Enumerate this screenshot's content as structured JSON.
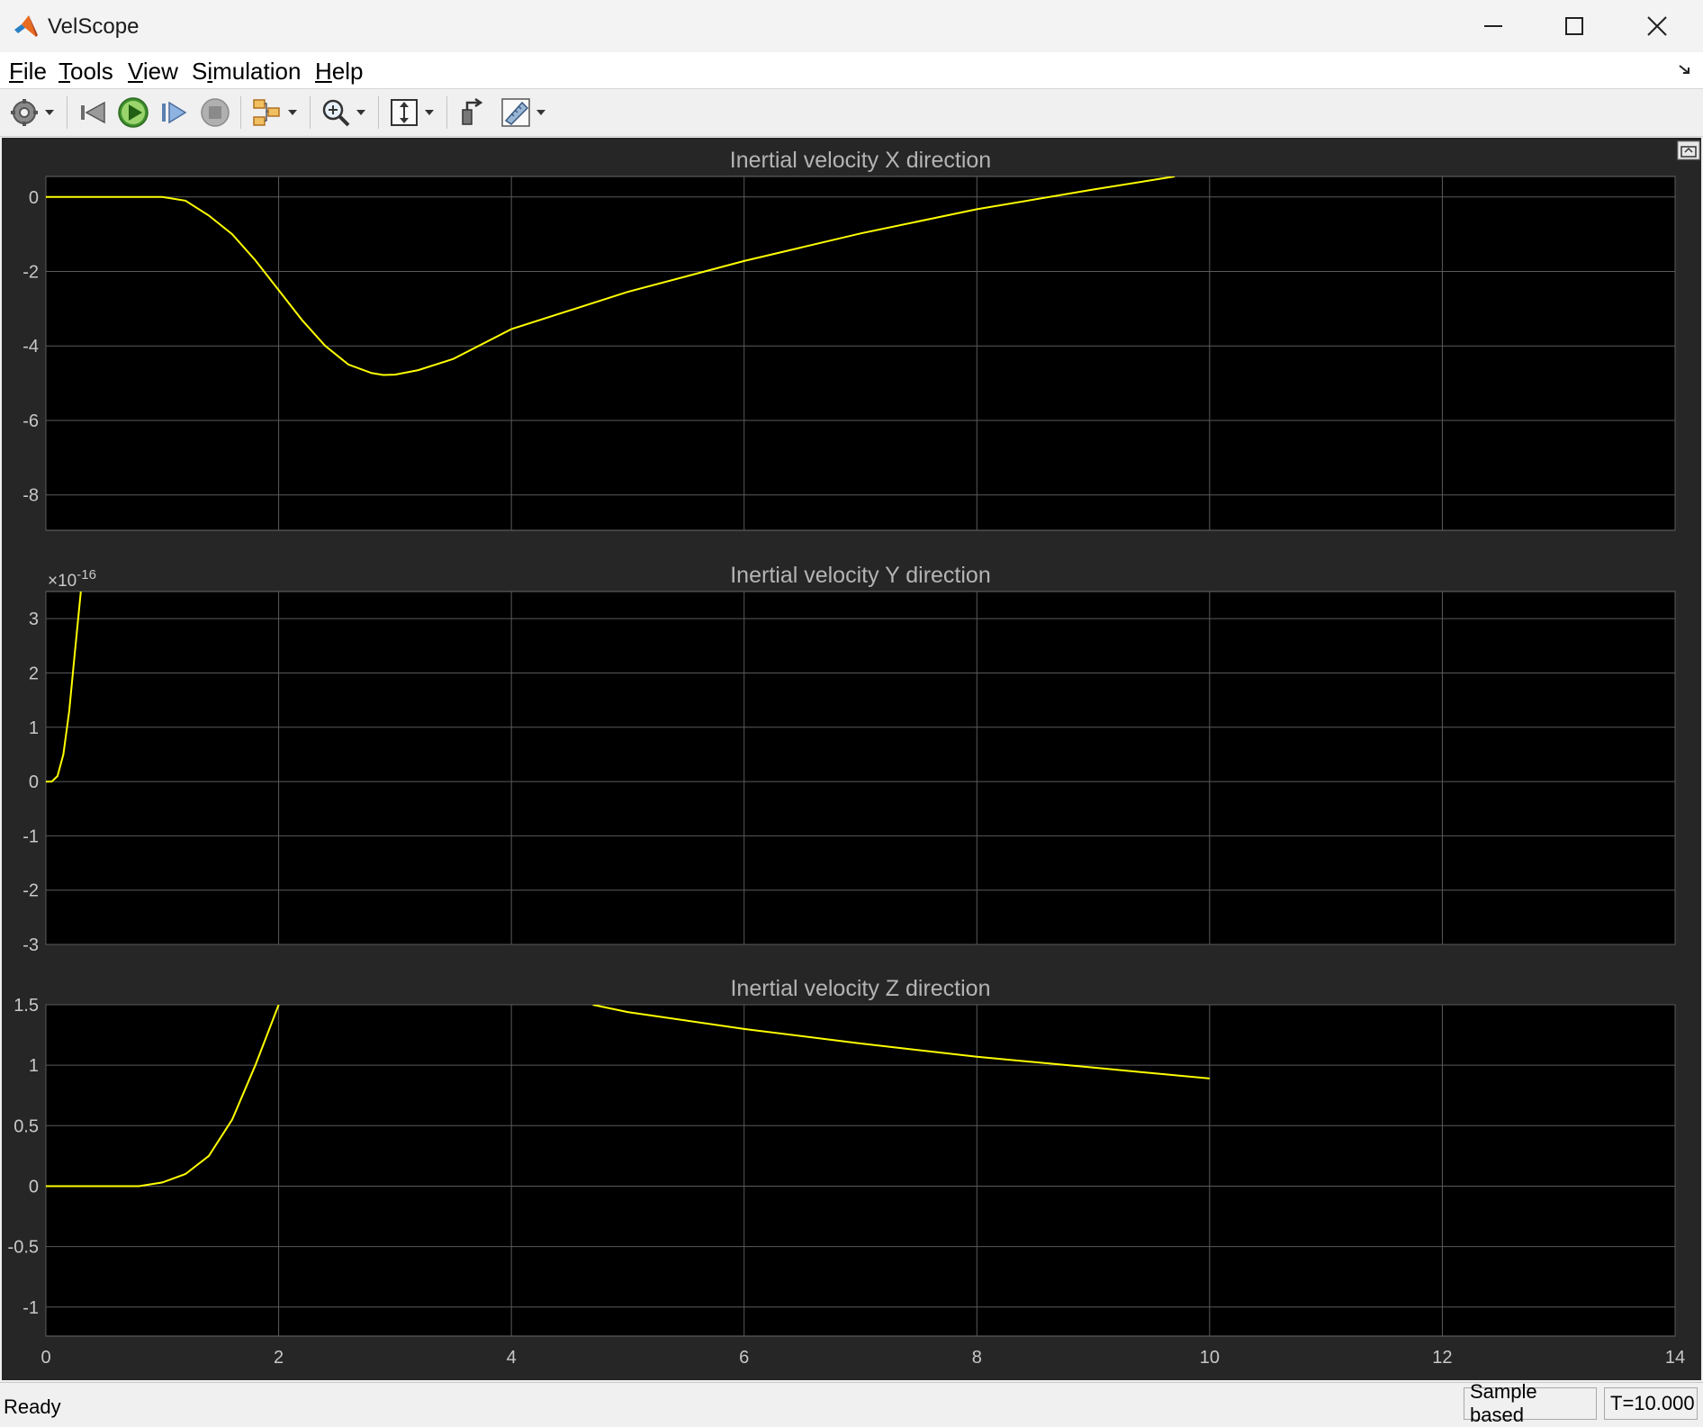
{
  "window": {
    "title": "VelScope"
  },
  "menu": [
    {
      "label": "File",
      "accel": "F",
      "rest": "ile"
    },
    {
      "label": "Tools",
      "accel": "T",
      "rest": "ools"
    },
    {
      "label": "View",
      "accel": "V",
      "rest": "iew"
    },
    {
      "label": "Simulation",
      "pre": "S",
      "accel": "i",
      "rest": "mulation"
    },
    {
      "label": "Help",
      "accel": "H",
      "rest": "elp"
    }
  ],
  "toolbar": {
    "icons": [
      "gear-icon",
      "step-back-icon",
      "run-icon",
      "step-forward-icon",
      "stop-icon",
      "signal-select-icon",
      "zoom-icon",
      "autoscale-icon",
      "highlight-block-icon",
      "measure-icon"
    ]
  },
  "status": {
    "left": "Ready",
    "mode": "Sample based",
    "time": "T=10.000"
  },
  "colors": {
    "trace": "#ffff00",
    "plot_bg": "#000000",
    "figure_bg": "#262626",
    "grid": "#5a5a5a",
    "text": "#c8c8c8"
  },
  "chart_data": [
    {
      "type": "line",
      "title": "Inertial velocity X direction",
      "xlim": [
        0,
        14
      ],
      "ylim": [
        -8.95,
        0.55
      ],
      "xticks": [
        0,
        2,
        4,
        6,
        8,
        10,
        12,
        14
      ],
      "yticks": [
        0,
        -2,
        -4,
        -6,
        -8
      ],
      "ytick_labels": [
        "0",
        "-2",
        "-4",
        "-6",
        "-8"
      ],
      "exponent_label": "",
      "grid": true,
      "series": [
        {
          "x": [
            0,
            0.5,
            1.0,
            1.2,
            1.4,
            1.6,
            1.8,
            2.0,
            2.2,
            2.4,
            2.6,
            2.8,
            2.9,
            3.0,
            3.2,
            3.5,
            4.0,
            5.0,
            6.0,
            7.0,
            8.0,
            9.0,
            9.7
          ],
          "y": [
            0,
            0,
            0,
            -0.1,
            -0.5,
            -1.0,
            -1.7,
            -2.5,
            -3.3,
            -4.0,
            -4.5,
            -4.73,
            -4.78,
            -4.77,
            -4.65,
            -4.35,
            -3.55,
            -2.55,
            -1.72,
            -0.98,
            -0.33,
            0.2,
            0.55
          ]
        }
      ]
    },
    {
      "type": "line",
      "title": "Inertial velocity Y direction",
      "xlim": [
        0,
        14
      ],
      "ylim": [
        -3,
        3.5
      ],
      "xticks": [
        0,
        2,
        4,
        6,
        8,
        10,
        12,
        14
      ],
      "yticks": [
        3,
        2,
        1,
        0,
        -1,
        -2,
        -3
      ],
      "ytick_labels": [
        "3",
        "2",
        "1",
        "0",
        "-1",
        "-2",
        "-3"
      ],
      "exponent_label": "×10^-16",
      "grid": true,
      "series": [
        {
          "x": [
            0,
            0.05,
            0.1,
            0.15,
            0.2,
            0.25,
            0.3
          ],
          "y": [
            0,
            0,
            0.1,
            0.5,
            1.3,
            2.4,
            3.5
          ]
        }
      ]
    },
    {
      "type": "line",
      "title": "Inertial velocity Z direction",
      "xlim": [
        0,
        14
      ],
      "ylim": [
        -1.24,
        1.5
      ],
      "xticks": [
        0,
        2,
        4,
        6,
        8,
        10,
        12,
        14
      ],
      "yticks": [
        1.5,
        1,
        0.5,
        0,
        -0.5,
        -1
      ],
      "ytick_labels": [
        "1.5",
        "1",
        "0.5",
        "0",
        "-0.5",
        "-1"
      ],
      "exponent_label": "",
      "grid": true,
      "series": [
        {
          "x": [
            0,
            0.5,
            0.8,
            1.0,
            1.2,
            1.4,
            1.6,
            1.8,
            2.0
          ],
          "y": [
            0,
            0,
            0,
            0.03,
            0.1,
            0.25,
            0.55,
            1.0,
            1.5
          ]
        },
        {
          "x": [
            4.7,
            5.0,
            6.0,
            7.0,
            8.0,
            9.0,
            10.0
          ],
          "y": [
            1.5,
            1.44,
            1.3,
            1.18,
            1.07,
            0.98,
            0.89
          ]
        }
      ]
    }
  ],
  "x_axis_labels": [
    "0",
    "2",
    "4",
    "6",
    "8",
    "10",
    "12",
    "14"
  ]
}
